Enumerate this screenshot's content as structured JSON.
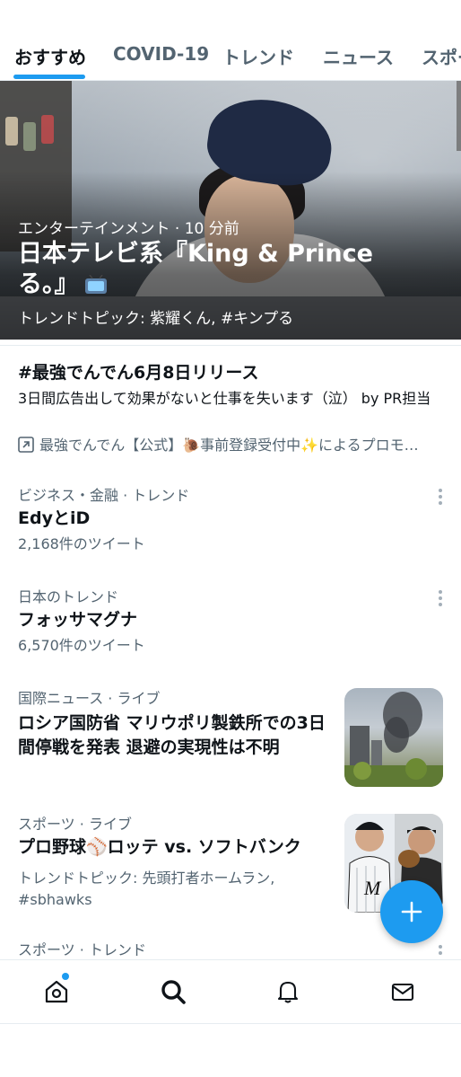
{
  "tabs": [
    {
      "label": "おすすめ",
      "active": true
    },
    {
      "label": "COVID-19",
      "active": false
    },
    {
      "label": "トレンド",
      "active": false
    },
    {
      "label": "ニュース",
      "active": false
    },
    {
      "label": "スポー",
      "active": false
    }
  ],
  "hero": {
    "category": "エンターテインメント",
    "time": "10 分前",
    "meta": "エンターテインメント · 10 分前",
    "title": "日本テレビ系『King & Prince る。』",
    "topic": "トレンドトピック: 紫耀くん, #キンプる"
  },
  "promoted": {
    "title": "#最強でんでん6月8日リリース",
    "description": "3日間広告出して効果がないと仕事を失います（泣） by PR担当",
    "promoter": "最強でんでん【公式】🐌事前登録受付中✨によるプロモ…"
  },
  "trends": [
    {
      "meta": "ビジネス・金融 · トレンド",
      "title": "EdyとiD",
      "count": "2,168件のツイート"
    },
    {
      "meta": "日本のトレンド",
      "title": "フォッサマグナ",
      "count": "6,570件のツイート"
    }
  ],
  "news": [
    {
      "meta": "国際ニュース · ライブ",
      "title": "ロシア国防省 マリウポリ製鉄所での3日間停戦を発表 退避の実現性は不明"
    },
    {
      "meta": "スポーツ · ライブ",
      "title": "プロ野球⚾ロッテ vs. ソフトバンク",
      "topic": "トレンドトピック: 先頭打者ホームラン, #sbhawks"
    }
  ],
  "partial_item": {
    "meta": "スポーツ · トレンド"
  },
  "colors": {
    "accent": "#1d9bf0",
    "text": "#0f1419",
    "secondary": "#536471"
  },
  "icons": {
    "nav": [
      "home-icon",
      "search-icon",
      "bell-icon",
      "mail-icon"
    ],
    "fab": "plus-icon"
  }
}
